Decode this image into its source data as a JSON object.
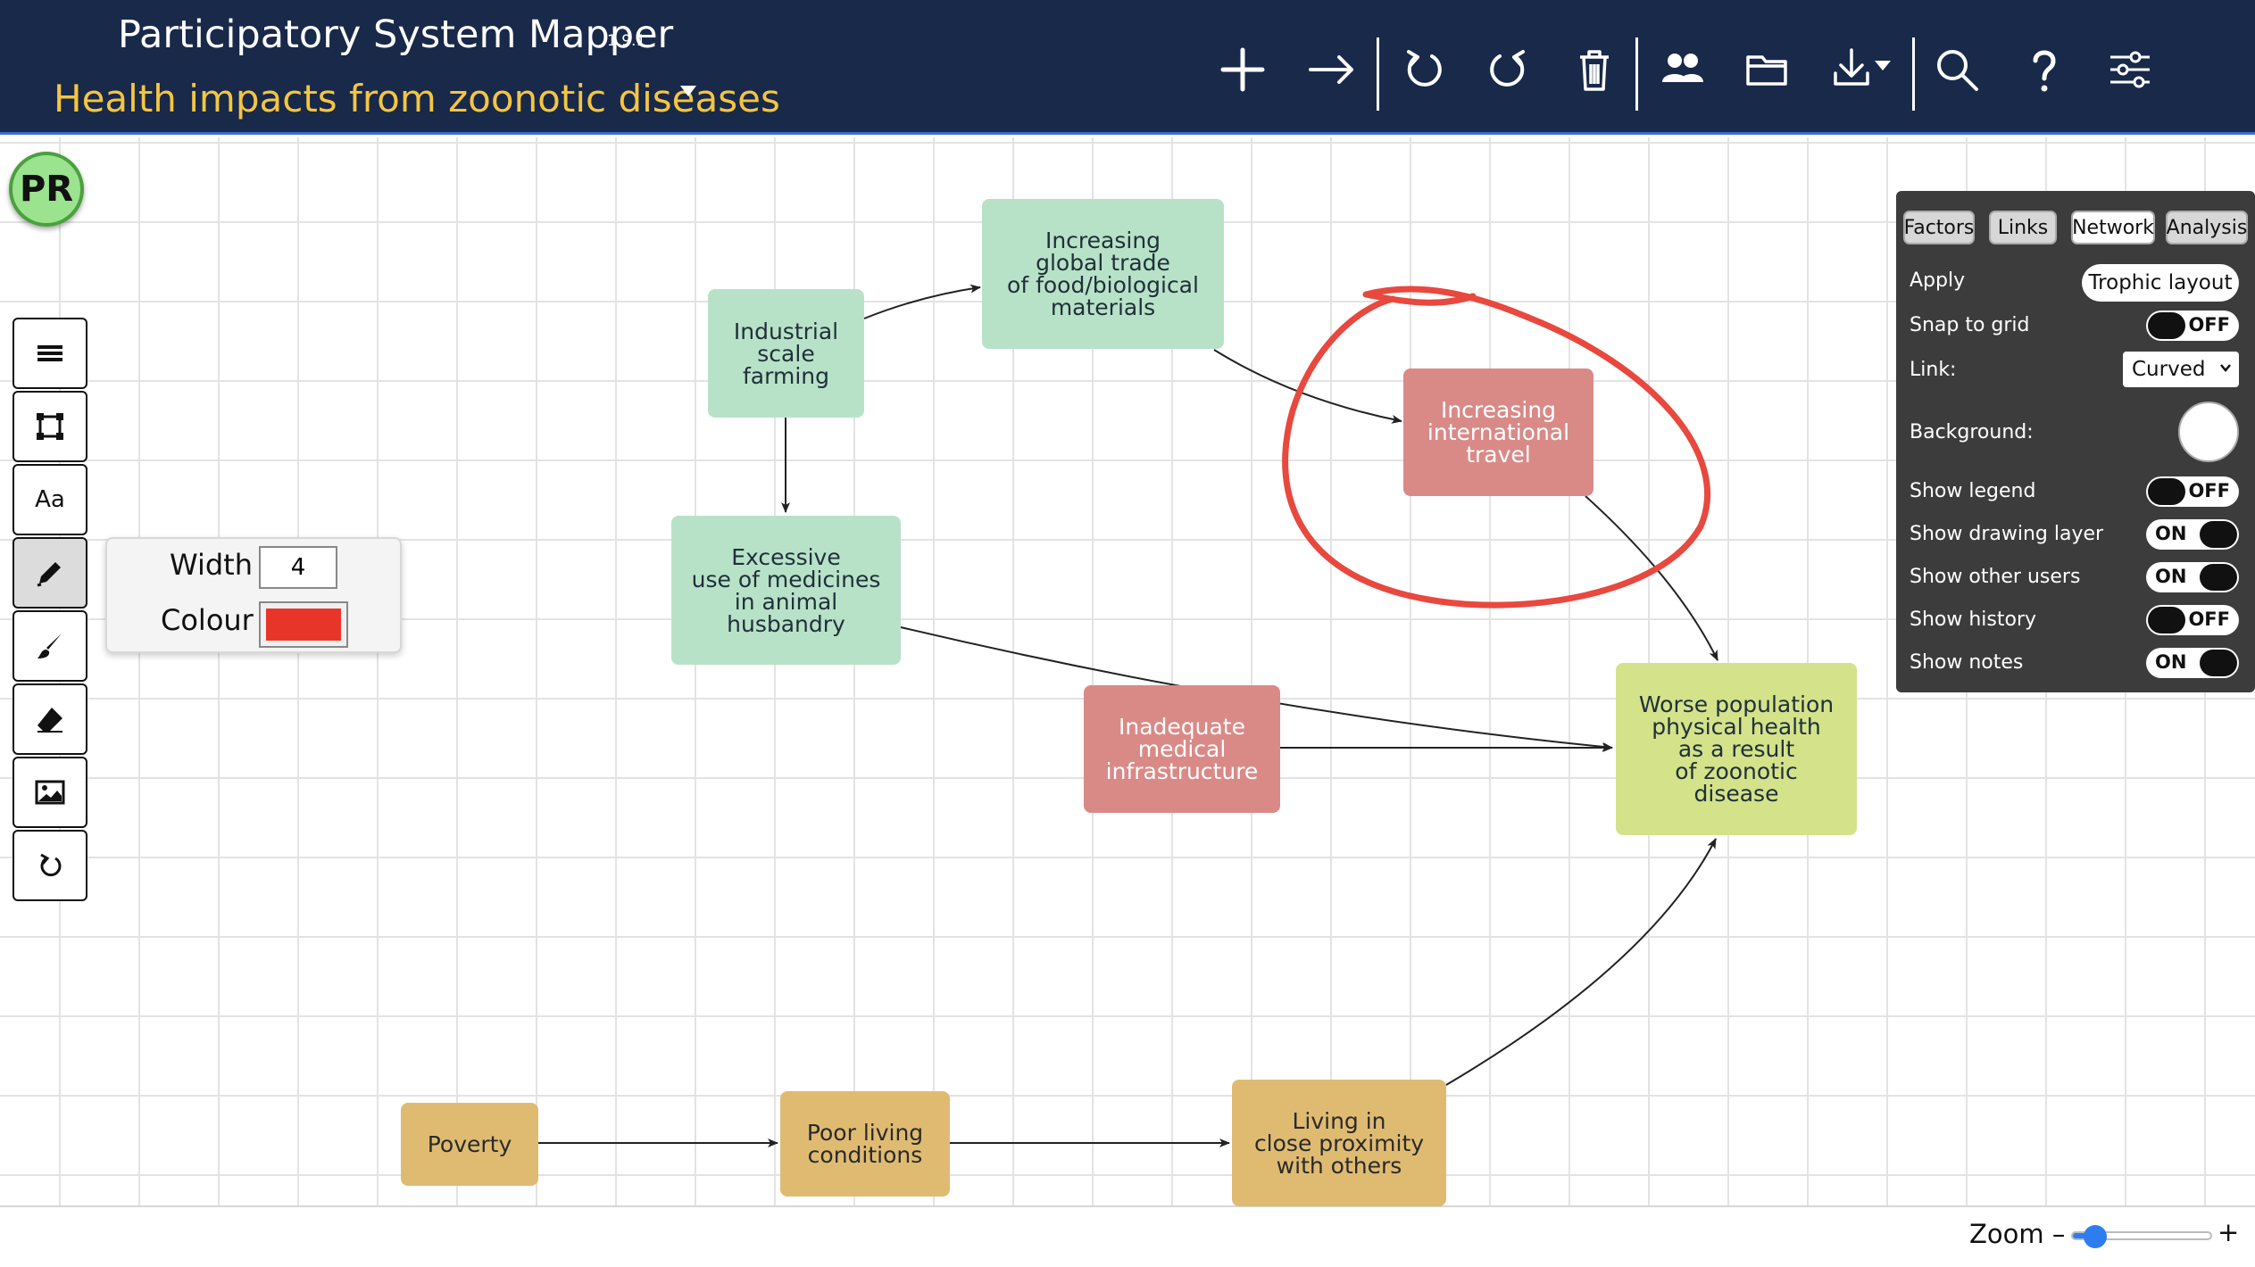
{
  "header": {
    "app_title": "Participatory System Mapper",
    "version": "1.9.1",
    "map_title": "Health impacts from zoonotic diseases"
  },
  "toolbar": {
    "icons": [
      "add-factor-icon",
      "add-link-icon",
      "undo-icon",
      "redo-icon",
      "delete-icon",
      "share-icon",
      "open-file-icon",
      "download-icon",
      "search-icon",
      "help-icon",
      "settings-icon"
    ]
  },
  "user": {
    "initials": "PR"
  },
  "drawing_tools": {
    "text_tool_label": "Aa",
    "icons": [
      "menu-icon",
      "rectangle-icon",
      "text-icon",
      "pen-icon",
      "brush-icon",
      "eraser-icon",
      "image-icon",
      "reset-icon"
    ]
  },
  "pen_options": {
    "width_label": "Width",
    "width_value": "4",
    "colour_label": "Colour",
    "colour_value": "#e8352a"
  },
  "nodes": [
    {
      "id": "industrial",
      "label": "Industrial\nscale\nfarming",
      "color": "green"
    },
    {
      "id": "trade",
      "label": "Increasing\nglobal trade\nof food/biological\nmaterials",
      "color": "green"
    },
    {
      "id": "travel",
      "label": "Increasing\ninternational\ntravel",
      "color": "red"
    },
    {
      "id": "medicines",
      "label": "Excessive\nuse of medicines\nin animal\nhusbandry",
      "color": "green"
    },
    {
      "id": "infrastructure",
      "label": "Inadequate\nmedical\ninfrastructure",
      "color": "red"
    },
    {
      "id": "health",
      "label": "Worse population\nphysical health\nas a result\nof zoonotic\ndisease",
      "color": "lime"
    },
    {
      "id": "poverty",
      "label": "Poverty",
      "color": "tan"
    },
    {
      "id": "living",
      "label": "Poor living\nconditions",
      "color": "tan"
    },
    {
      "id": "proximity",
      "label": "Living in\nclose proximity\nwith others",
      "color": "tan"
    }
  ],
  "node_colors": {
    "green": "#b8e2c8",
    "red": "#d98a87",
    "lime": "#d4e28a",
    "tan": "#dfbb72"
  },
  "edges": [
    {
      "from": "industrial",
      "to": "trade"
    },
    {
      "from": "industrial",
      "to": "medicines"
    },
    {
      "from": "trade",
      "to": "travel"
    },
    {
      "from": "travel",
      "to": "health"
    },
    {
      "from": "medicines",
      "to": "health"
    },
    {
      "from": "infrastructure",
      "to": "health"
    },
    {
      "from": "poverty",
      "to": "living"
    },
    {
      "from": "living",
      "to": "proximity"
    },
    {
      "from": "proximity",
      "to": "health"
    }
  ],
  "annotation_color": "#e8483e",
  "settings_panel": {
    "tabs": [
      "Factors",
      "Links",
      "Network",
      "Analysis"
    ],
    "active_tab": "Network",
    "apply_label": "Apply",
    "trophic_button": "Trophic layout",
    "snap_label": "Snap to grid",
    "snap_value": "OFF",
    "link_label": "Link:",
    "link_value": "Curved",
    "background_label": "Background:",
    "background_value": "#ffffff",
    "legend_label": "Show legend",
    "legend_value": "OFF",
    "drawing_label": "Show drawing layer",
    "drawing_value": "ON",
    "others_label": "Show other users",
    "others_value": "ON",
    "history_label": "Show history",
    "history_value": "OFF",
    "notes_label": "Show notes",
    "notes_value": "ON"
  },
  "zoom": {
    "label": "Zoom –",
    "plus": "+",
    "level": 0.16
  }
}
